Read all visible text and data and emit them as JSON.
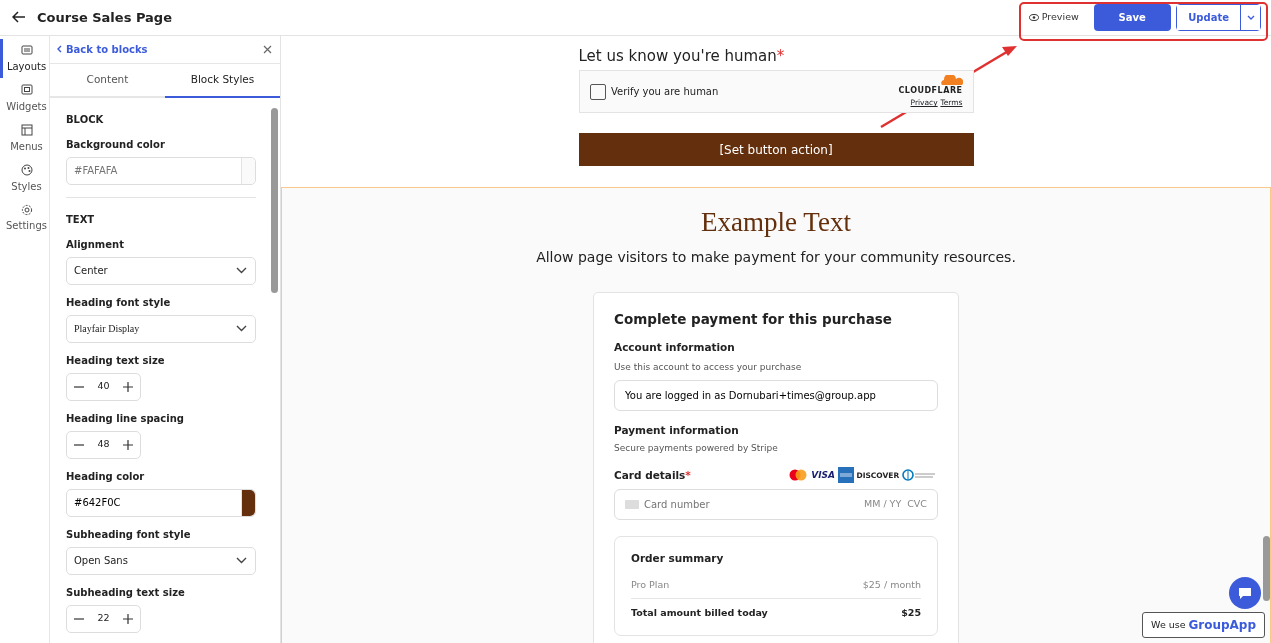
{
  "header": {
    "title": "Course Sales Page",
    "preview": "Preview",
    "save": "Save",
    "update": "Update"
  },
  "rail": [
    {
      "label": "Layouts",
      "selected": true
    },
    {
      "label": "Widgets",
      "selected": false
    },
    {
      "label": "Menus",
      "selected": false
    },
    {
      "label": "Styles",
      "selected": false
    },
    {
      "label": "Settings",
      "selected": false
    }
  ],
  "panel": {
    "back_link": "Back to blocks",
    "tabs": [
      {
        "label": "Content",
        "selected": false
      },
      {
        "label": "Block Styles",
        "selected": true
      }
    ],
    "fields": [
      {
        "kind": "section",
        "label": "BLOCK"
      },
      {
        "kind": "color",
        "label": "Background color",
        "placeholder": "#FAFAFA"
      },
      {
        "kind": "section",
        "label": "TEXT"
      },
      {
        "kind": "select",
        "label": "Alignment",
        "value": "Center"
      },
      {
        "kind": "select",
        "label": "Heading font style",
        "value": "Playfair Display",
        "serif": true
      },
      {
        "kind": "stepper",
        "label": "Heading text size",
        "value": "40"
      },
      {
        "kind": "stepper",
        "label": "Heading line spacing",
        "value": "48"
      },
      {
        "kind": "color",
        "label": "Heading color",
        "value": "#642F0C",
        "color": "#642f0c"
      },
      {
        "kind": "select",
        "label": "Subheading font style",
        "value": "Open Sans"
      },
      {
        "kind": "stepper",
        "label": "Subheading text size",
        "value": "22"
      }
    ]
  },
  "captcha_block": {
    "label": "Let us know you're human",
    "required": "*",
    "checkbox_label": "Verify you are human",
    "checked": false,
    "provider": "CLOUDFLARE",
    "links": [
      "Privacy",
      "Terms"
    ],
    "button": "[Set button action]"
  },
  "payment_block": {
    "heading": "Example Text",
    "subheading": "Allow page visitors to make payment for your community resources.",
    "card_title": "Complete payment for this purchase",
    "account_heading": "Account information",
    "account_note": "Use this account to access your purchase",
    "account_value": "You are logged in as Dornubari+times@group.app",
    "payment_heading": "Payment information",
    "payment_note": "Secure payments powered by Stripe",
    "card_label": "Card details",
    "required": "*",
    "brands": [
      "VISA",
      "DISCOVER"
    ],
    "card_placeholder": "Card number",
    "expiry_placeholder": "MM / YY",
    "cvc_placeholder": "CVC",
    "summary_title": "Order summary",
    "summary_rows": [
      {
        "label": "Pro Plan",
        "value": "$25 / month"
      }
    ],
    "total_label": "Total amount billed today",
    "total_value": "$25"
  },
  "footer_badge": {
    "prefix": "We use",
    "brand": "GroupApp"
  }
}
